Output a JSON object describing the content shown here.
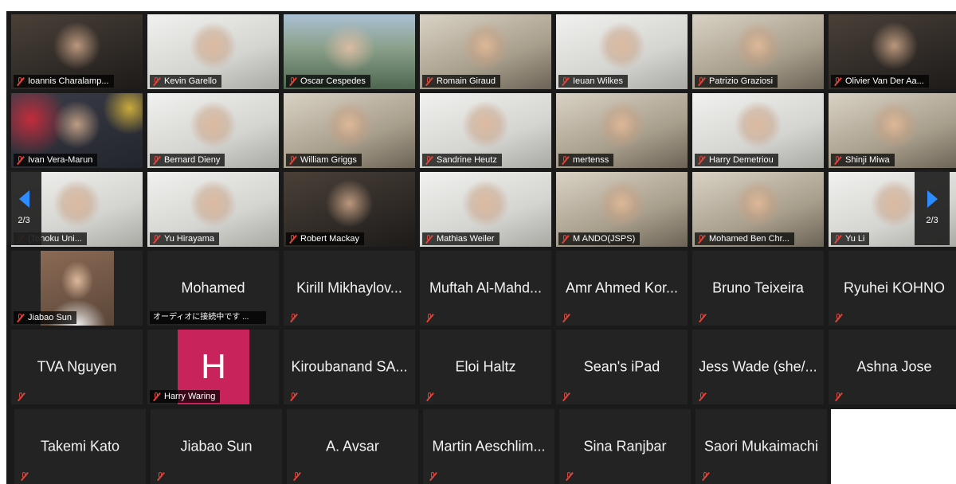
{
  "participants_page": "2/3",
  "video_rows": [
    [
      {
        "name": "Ioannis Charalamp...",
        "style": "dark"
      },
      {
        "name": "Kevin Garello",
        "style": "light"
      },
      {
        "name": "Oscar Cespedes",
        "style": "mountain"
      },
      {
        "name": "Romain Giraud",
        "style": "warm"
      },
      {
        "name": "Ieuan Wilkes",
        "style": "light"
      },
      {
        "name": "Patrizio Graziosi",
        "style": "warm"
      },
      {
        "name": "Olivier Van Der Aa...",
        "style": "dark"
      }
    ],
    [
      {
        "name": "Ivan Vera-Marun",
        "style": "neon"
      },
      {
        "name": "Bernard Dieny",
        "style": "light"
      },
      {
        "name": "William Griggs",
        "style": "warm"
      },
      {
        "name": "Sandrine Heutz",
        "style": "light"
      },
      {
        "name": "mertenss",
        "style": "warm"
      },
      {
        "name": "Harry Demetriou",
        "style": "light"
      },
      {
        "name": "Shinji Miwa",
        "style": "warm"
      }
    ],
    [
      {
        "name": "(Tohoku Uni...",
        "style": "light"
      },
      {
        "name": "Yu Hirayama",
        "style": "light"
      },
      {
        "name": "Robert Mackay",
        "style": "dark"
      },
      {
        "name": "Mathias Weiler",
        "style": "light"
      },
      {
        "name": "M ANDO(JSPS)",
        "style": "warm"
      },
      {
        "name": "Mohamed Ben Chr...",
        "style": "warm"
      },
      {
        "name": "Yu Li",
        "style": "light"
      }
    ]
  ],
  "jiabao_tile": {
    "name": "Jiabao Sun"
  },
  "mohamed_tile": {
    "name": "Mohamed",
    "status": "オーディオに接続中です ..."
  },
  "harry_waring_tile": {
    "name": "Harry Waring",
    "initial": "H",
    "avatar_color": "#c8235a"
  },
  "text_rows": [
    [
      "Kirill Mikhaylov...",
      "Muftah Al-Mahd...",
      "Amr Ahmed Kor...",
      "Bruno Teixeira",
      "Ryuhei KOHNO"
    ],
    [
      "TVA Nguyen",
      "Kiroubanand SA...",
      "Eloi Haltz",
      "Sean's iPad",
      "Jess Wade (she/...",
      "Ashna Jose"
    ],
    [
      "Takemi Kato",
      "Jiabao Sun",
      "A. Avsar",
      "Martin Aeschlim...",
      "Sina Ranjbar",
      "Saori Mukaimachi"
    ]
  ],
  "colors": {
    "mute_icon": "#e0443a",
    "nav_arrow": "#2d8cff",
    "tile_bg": "#232323"
  }
}
